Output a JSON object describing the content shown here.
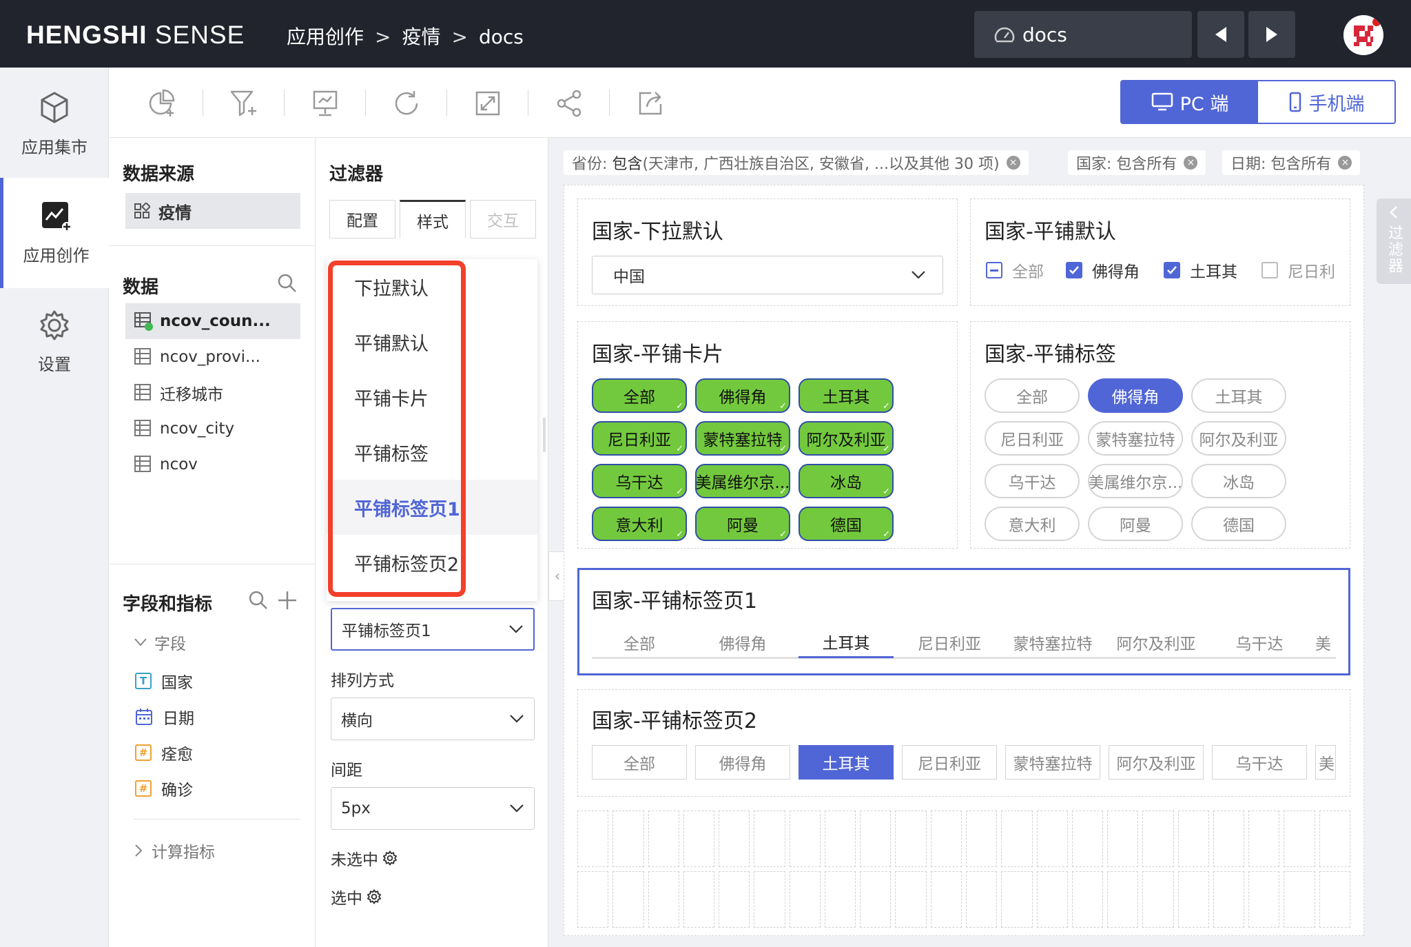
{
  "header": {
    "brand_bold": "HENGSHI",
    "brand_light": " SENSE",
    "breadcrumb": [
      "应用创作",
      "疫情",
      "docs"
    ],
    "breadcrumb_sep": ">",
    "dashboard_name": "docs"
  },
  "rail": {
    "items": [
      {
        "label": "应用集市",
        "icon": "cube-icon"
      },
      {
        "label": "应用创作",
        "icon": "chart-create-icon"
      },
      {
        "label": "设置",
        "icon": "gear-icon"
      }
    ]
  },
  "toolbar": {
    "device_pc": "PC 端",
    "device_mobile": "手机端"
  },
  "datapanel": {
    "source_title": "数据来源",
    "source_name": "疫情",
    "data_title": "数据",
    "tables": [
      "ncov_coun...",
      "ncov_provi...",
      "迁移城市",
      "ncov_city",
      "ncov"
    ],
    "fields_title": "字段和指标",
    "fields_group": "字段",
    "fields": [
      {
        "name": "国家",
        "type": "T",
        "color": "#3aa0c8"
      },
      {
        "name": "日期",
        "type": "date",
        "color": "#5066d6"
      },
      {
        "name": "痊愈",
        "type": "#",
        "color": "#f0a030"
      },
      {
        "name": "确诊",
        "type": "#",
        "color": "#f0a030"
      }
    ],
    "calc_title": "计算指标"
  },
  "filterpanel": {
    "title": "过滤器",
    "tabs": [
      "配置",
      "样式",
      "交互"
    ],
    "dropdown_options": [
      "下拉默认",
      "平铺默认",
      "平铺卡片",
      "平铺标签",
      "平铺标签页1",
      "平铺标签页2"
    ],
    "selected_style": "平铺标签页1",
    "arrange_label": "排列方式",
    "arrange_value": "横向",
    "spacing_label": "间距",
    "spacing_value": "5px",
    "unselected_label": "未选中",
    "selected_label": "选中"
  },
  "chips": [
    {
      "label": "省份:",
      "value": "包含",
      "detail": "(天津市, 广西壮族自治区, 安徽省, ...以及其他 30 项)"
    },
    {
      "label": "国家:",
      "value": "",
      "detail": "包含所有"
    },
    {
      "label": "日期:",
      "value": "",
      "detail": "包含所有"
    }
  ],
  "widgets": {
    "dropdown": {
      "title": "国家-下拉默认",
      "value": "中国"
    },
    "tile_default": {
      "title": "国家-平铺默认",
      "items": [
        "全部",
        "佛得角",
        "土耳其",
        "尼日利"
      ]
    },
    "tile_card": {
      "title": "国家-平铺卡片",
      "items": [
        "全部",
        "佛得角",
        "土耳其",
        "尼日利亚",
        "蒙特塞拉特",
        "阿尔及利亚",
        "乌干达",
        "美属维尔京...",
        "冰岛",
        "意大利",
        "阿曼",
        "德国"
      ]
    },
    "tile_tag": {
      "title": "国家-平铺标签",
      "items": [
        "全部",
        "佛得角",
        "土耳其",
        "尼日利亚",
        "蒙特塞拉特",
        "阿尔及利亚",
        "乌干达",
        "美属维尔京...",
        "冰岛",
        "意大利",
        "阿曼",
        "德国"
      ]
    },
    "tab_page1": {
      "title": "国家-平铺标签页1",
      "items": [
        "全部",
        "佛得角",
        "土耳其",
        "尼日利亚",
        "蒙特塞拉特",
        "阿尔及利亚",
        "乌干达",
        "美"
      ]
    },
    "tab_page2": {
      "title": "国家-平铺标签页2",
      "items": [
        "全部",
        "佛得角",
        "土耳其",
        "尼日利亚",
        "蒙特塞拉特",
        "阿尔及利亚",
        "乌干达",
        "美"
      ]
    }
  },
  "side_tab": {
    "label": "过滤器"
  },
  "colors": {
    "accent": "#5066d6",
    "card_green": "#73c93d",
    "highlight_red": "#f2402a",
    "topbar": "#21242d"
  }
}
